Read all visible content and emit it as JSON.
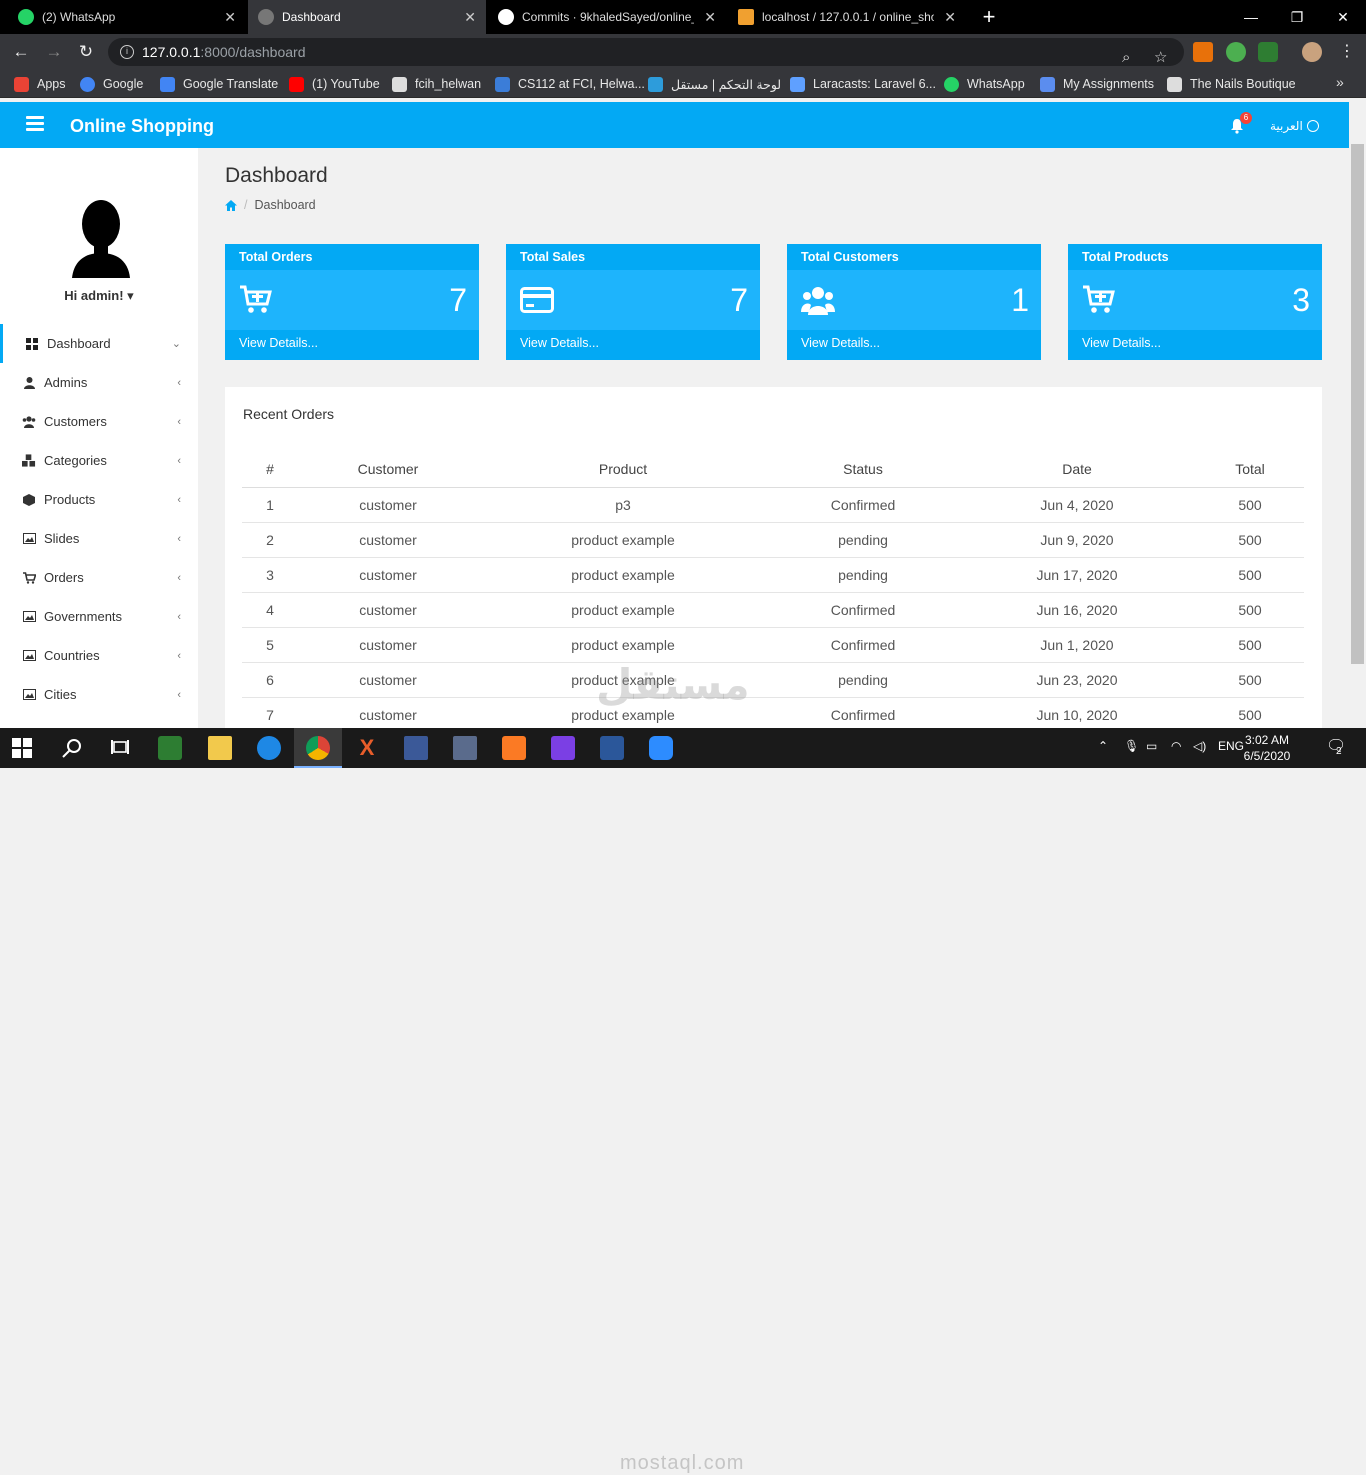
{
  "browser": {
    "tabs": [
      {
        "label": "(2) WhatsApp",
        "color": "#25d366"
      },
      {
        "label": "Dashboard",
        "color": "#777777"
      },
      {
        "label": "Commits · 9khaledSayed/online_",
        "color": "#ffffff"
      },
      {
        "label": "localhost / 127.0.0.1 / online_sho",
        "color": "#f0a030"
      }
    ],
    "url_host": "127.0.0.1",
    "url_path": ":8000/dashboard",
    "bookmarks": [
      {
        "label": "Apps",
        "color": "#ea4335"
      },
      {
        "label": "Google",
        "color": "#4285f4"
      },
      {
        "label": "Google Translate",
        "color": "#4285f4"
      },
      {
        "label": "(1) YouTube",
        "color": "#ff0000"
      },
      {
        "label": "fcih_helwan",
        "color": "#dddddd"
      },
      {
        "label": "CS112 at FCI, Helwa...",
        "color": "#3b7dd8"
      },
      {
        "label": "لوحة التحكم | مستقل",
        "color": "#2d9cdb"
      },
      {
        "label": "Laracasts: Laravel 6...",
        "color": "#5fa0ff"
      },
      {
        "label": "WhatsApp",
        "color": "#25d366"
      },
      {
        "label": "My Assignments",
        "color": "#5b8def"
      },
      {
        "label": "The Nails Boutique",
        "color": "#dddddd"
      }
    ]
  },
  "app": {
    "brand": "Online Shopping",
    "notification_count": "6",
    "language": "العربية",
    "accent": "#03a9f4"
  },
  "sidebar": {
    "greeting": "Hi admin!",
    "items": [
      {
        "label": "Dashboard",
        "icon": "dashboard-icon"
      },
      {
        "label": "Admins",
        "icon": "user-icon"
      },
      {
        "label": "Customers",
        "icon": "users-icon"
      },
      {
        "label": "Categories",
        "icon": "cubes-icon"
      },
      {
        "label": "Products",
        "icon": "cube-icon"
      },
      {
        "label": "Slides",
        "icon": "image-icon"
      },
      {
        "label": "Orders",
        "icon": "cart-icon"
      },
      {
        "label": "Governments",
        "icon": "image-icon"
      },
      {
        "label": "Countries",
        "icon": "image-icon"
      },
      {
        "label": "Cities",
        "icon": "image-icon"
      }
    ]
  },
  "main": {
    "title": "Dashboard",
    "breadcrumb": "Dashboard",
    "cards": [
      {
        "title": "Total Orders",
        "value": "7",
        "footer": "View Details...",
        "icon": "cart-plus-icon"
      },
      {
        "title": "Total Sales",
        "value": "7",
        "footer": "View Details...",
        "icon": "credit-card-icon"
      },
      {
        "title": "Total Customers",
        "value": "1",
        "footer": "View Details...",
        "icon": "users-icon"
      },
      {
        "title": "Total Products",
        "value": "3",
        "footer": "View Details...",
        "icon": "cart-plus-icon"
      }
    ],
    "recent_orders": {
      "title": "Recent Orders",
      "columns": [
        "#",
        "Customer",
        "Product",
        "Status",
        "Date",
        "Total"
      ],
      "rows": [
        {
          "id": "1",
          "customer": "customer",
          "product": "p3",
          "status": "Confirmed",
          "date": "Jun 4, 2020",
          "total": "500"
        },
        {
          "id": "2",
          "customer": "customer",
          "product": "product example",
          "status": "pending",
          "date": "Jun 9, 2020",
          "total": "500"
        },
        {
          "id": "3",
          "customer": "customer",
          "product": "product example",
          "status": "pending",
          "date": "Jun 17, 2020",
          "total": "500"
        },
        {
          "id": "4",
          "customer": "customer",
          "product": "product example",
          "status": "Confirmed",
          "date": "Jun 16, 2020",
          "total": "500"
        },
        {
          "id": "5",
          "customer": "customer",
          "product": "product example",
          "status": "Confirmed",
          "date": "Jun 1, 2020",
          "total": "500"
        },
        {
          "id": "6",
          "customer": "customer",
          "product": "product example",
          "status": "pending",
          "date": "Jun 23, 2020",
          "total": "500"
        },
        {
          "id": "7",
          "customer": "customer",
          "product": "product example",
          "status": "Confirmed",
          "date": "Jun 10, 2020",
          "total": "500"
        }
      ]
    }
  },
  "taskbar": {
    "language": "ENG",
    "time": "3:02 AM",
    "date": "6/5/2020",
    "notifications": "2"
  },
  "watermark": {
    "text": "مستقل",
    "site": "mostaql.com"
  }
}
